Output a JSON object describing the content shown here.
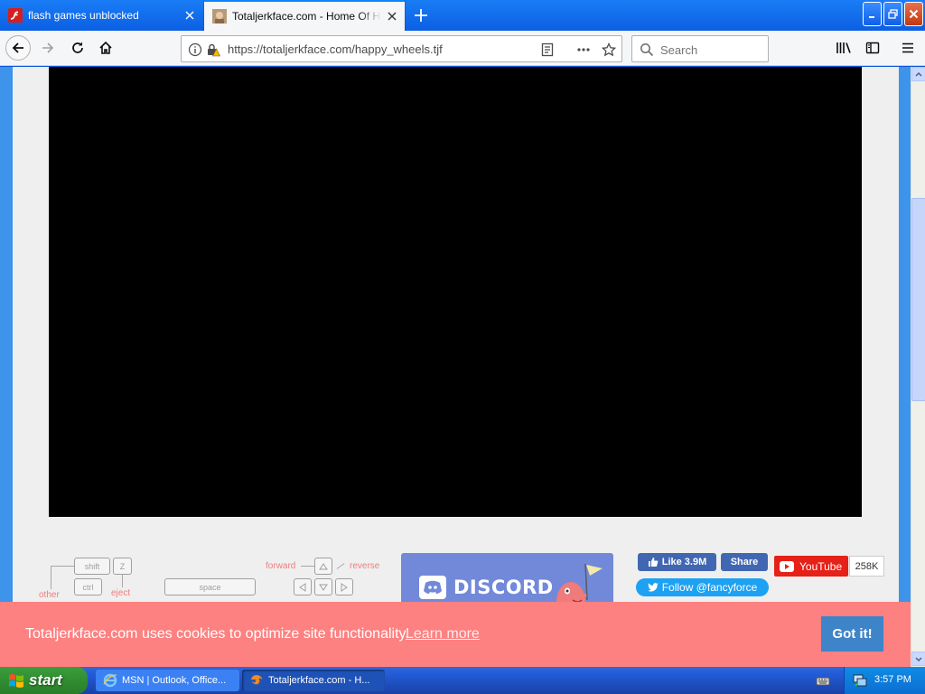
{
  "browser": {
    "tabs": [
      {
        "title": "flash games unblocked",
        "active": false
      },
      {
        "title": "Totaljerkface.com - Home Of Happ",
        "active": true
      }
    ],
    "url": "https://totaljerkface.com/happy_wheels.tjf",
    "search_placeholder": "Search"
  },
  "controls": {
    "shift": "shift",
    "z": "Z",
    "ctrl": "ctrl",
    "space": "space",
    "other_label": "other",
    "eject_label": "eject",
    "forward_label": "forward",
    "reverse_label": "reverse"
  },
  "social": {
    "discord": "DISCORD",
    "fb_like": "Like 3.9M",
    "fb_share": "Share",
    "youtube": "YouTube",
    "youtube_count": "258K",
    "twitter": "Follow @fancyforce"
  },
  "cookie": {
    "message": "Totaljerkface.com uses cookies to optimize site functionality.",
    "learn_more": "Learn more",
    "accept": "Got it!"
  },
  "taskbar": {
    "start": "start",
    "tasks": [
      {
        "title": "MSN | Outlook, Office..."
      },
      {
        "title": "Totaljerkface.com - H..."
      }
    ],
    "clock": "3:57 PM"
  },
  "colors": {
    "page_background": "#3d94ea",
    "cookie_banner": "#fd8181",
    "cookie_button": "#3e84c8",
    "discord": "#7289da",
    "youtube": "#e62117",
    "twitter": "#1da1f2",
    "facebook": "#4267b2"
  }
}
